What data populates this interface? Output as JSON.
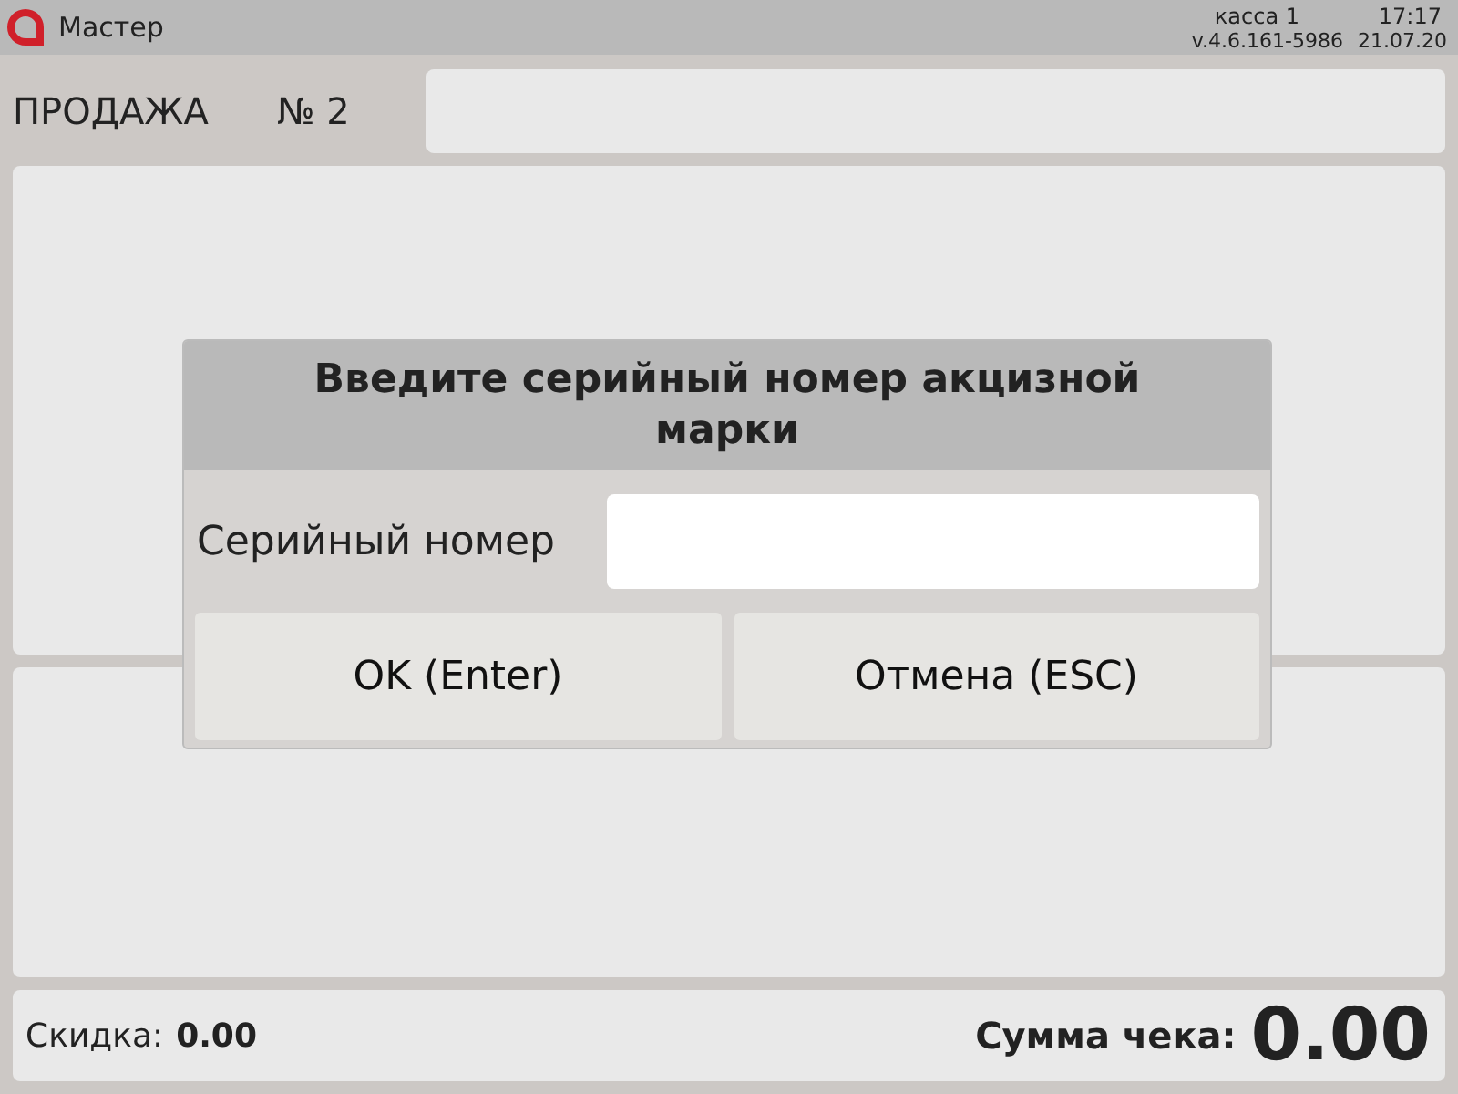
{
  "top_bar": {
    "title": "Мастер",
    "register": "касса 1",
    "time": "17:17",
    "version": "v.4.6.161-5986",
    "date": "21.07.20"
  },
  "header": {
    "mode": "ПРОДАЖА",
    "receipt_number": "№ 2"
  },
  "dialog": {
    "title": "Введите серийный номер акцизной марки",
    "field_label": "Серийный номер",
    "buttons": [
      "OK (Enter)",
      "Отмена (ESC)"
    ]
  },
  "footer": {
    "discount_label": "Скидка:",
    "discount_value": "0.00",
    "total_label": "Сумма чека:",
    "total_value": "0.00"
  }
}
